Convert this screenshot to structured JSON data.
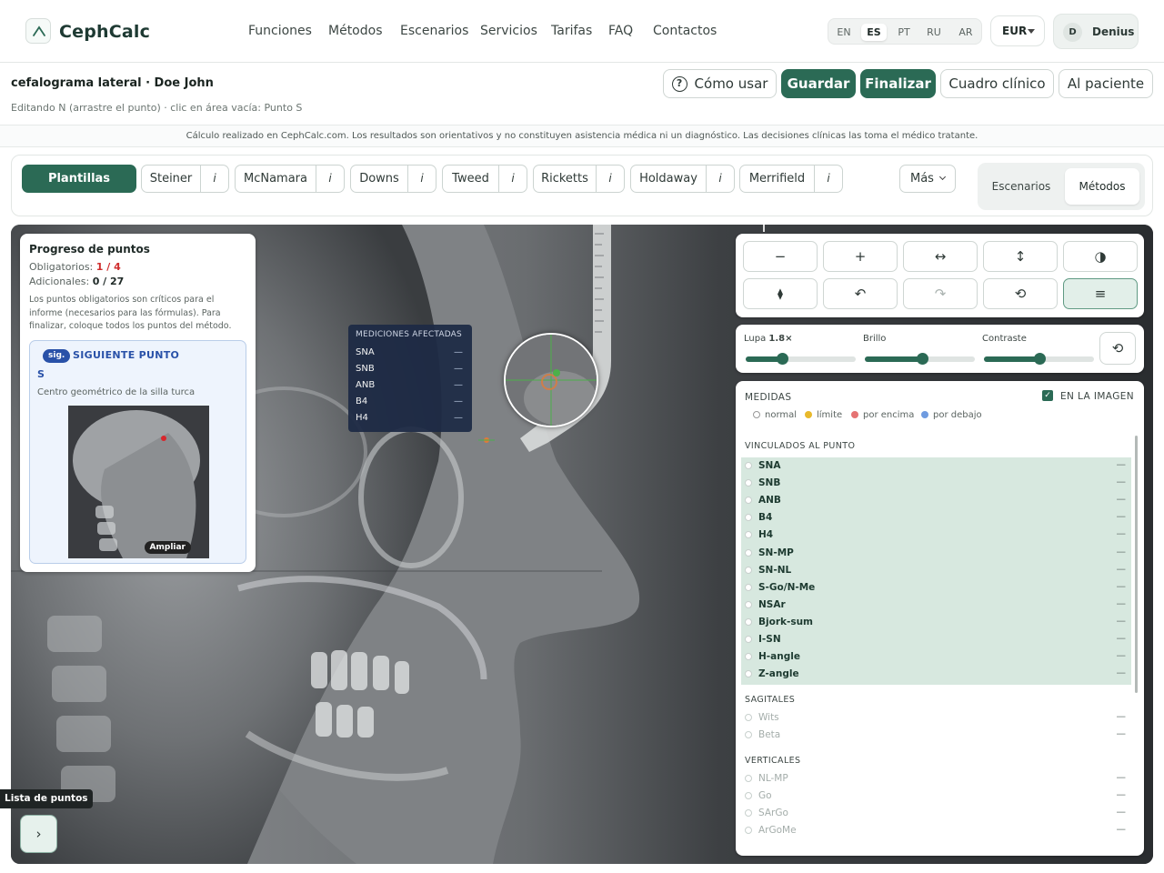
{
  "brand": {
    "name": "CephCalc"
  },
  "nav": {
    "links": [
      "Funciones",
      "Métodos",
      "Escenarios",
      "Servicios",
      "Tarifas",
      "FAQ",
      "Contactos"
    ]
  },
  "languages": {
    "items": [
      "EN",
      "ES",
      "PT",
      "RU",
      "AR"
    ],
    "active": "ES"
  },
  "currency": {
    "value": "EUR"
  },
  "user": {
    "initial": "D",
    "name": "Denius"
  },
  "study": {
    "title": "cefalograma lateral · Doe John",
    "subtitle": "Editando N (arrastre el punto) · clic en área vacía: Punto S"
  },
  "actions": {
    "how_to": "Cómo usar",
    "save": "Guardar",
    "finish": "Finalizar",
    "clinical": "Cuadro clínico",
    "patient": "Al paciente"
  },
  "disclaimer": "Cálculo realizado en CephCalc.com. Los resultados son orientativos y no constituyen asistencia médica ni un diagnóstico. Las decisiones clínicas las toma el médico tratante.",
  "methods": {
    "templates": "Plantillas propias",
    "items": [
      "Steiner",
      "McNamara",
      "Downs",
      "Tweed",
      "Ricketts",
      "Holdaway",
      "Merrifield"
    ],
    "info": "i",
    "more": "Más",
    "tabs": [
      "Escenarios",
      "Métodos"
    ],
    "active_tab": "Métodos"
  },
  "progress": {
    "title": "Progreso de puntos",
    "required_label": "Obligatorios:",
    "required_value": "1 / 4",
    "optional_label": "Adicionales:",
    "optional_value": "0 / 27",
    "note": "Los puntos obligatorios son críticos para el informe (necesarios para las fórmulas). Para finalizar, coloque todos los puntos del método.",
    "next_badge": "sig.",
    "next_label": "SIGUIENTE PUNTO",
    "next_code": "S",
    "next_desc": "Centro geométrico de la silla turca",
    "enlarge": "Ampliar"
  },
  "affected": {
    "title": "MEDICIONES AFECTADAS",
    "rows": [
      "SNA",
      "SNB",
      "ANB",
      "B4",
      "H4"
    ],
    "dash": "—"
  },
  "tools": {
    "row1": [
      "−",
      "+",
      "↔",
      "↕",
      "◑"
    ],
    "row2": [
      "⧫",
      "↶",
      "↷",
      "⟲",
      "≡"
    ]
  },
  "sliders": {
    "zoom_label": "Lupa",
    "zoom_value": "1.8×",
    "zoom_level": 0.33,
    "brightness_label": "Brillo",
    "brightness_level": 0.52,
    "contrast_label": "Contraste",
    "contrast_level": 0.5,
    "reset": "⟲"
  },
  "measures": {
    "title": "MEDIDAS",
    "on_image": "EN LA IMAGEN",
    "legend": [
      "normal",
      "límite",
      "por encima",
      "por debajo"
    ],
    "legend_colors": [
      "#ffffff",
      "#e8b92c",
      "#e57373",
      "#6f9be0"
    ],
    "linked_title": "VINCULADOS AL PUNTO",
    "linked": [
      "SNA",
      "SNB",
      "ANB",
      "B4",
      "H4",
      "SN-MP",
      "SN-NL",
      "S-Go/N-Me",
      "NSAr",
      "Bjork-sum",
      "I-SN",
      "H-angle",
      "Z-angle"
    ],
    "sagittal_title": "SAGITALES",
    "sagittal": [
      "Wits",
      "Beta"
    ],
    "vertical_title": "VERTICALES",
    "vertical": [
      "NL-MP",
      "Go",
      "SArGo",
      "ArGoMe"
    ],
    "dash": "—"
  },
  "points_list": {
    "label": "Lista de puntos",
    "toggle": "›"
  },
  "colors": {
    "primary": "#2b6a55",
    "accent_blue": "#2951a8",
    "danger": "#cf2d2d"
  }
}
